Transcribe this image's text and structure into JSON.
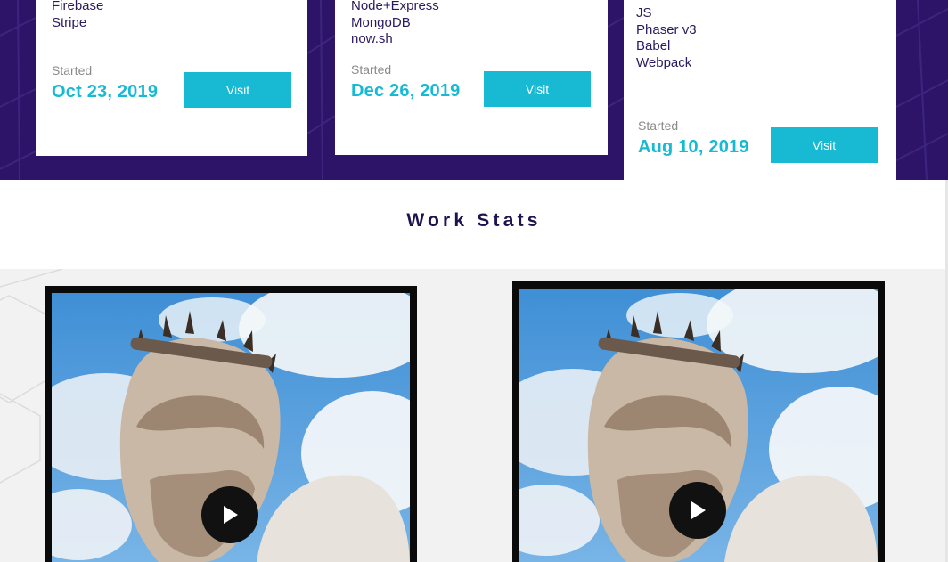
{
  "projects": [
    {
      "tech": [
        "Firebase",
        "Stripe"
      ],
      "started_label": "Started",
      "started_date": "Oct 23, 2019",
      "visit_label": "Visit"
    },
    {
      "tech": [
        "Node+Express",
        "MongoDB",
        "now.sh"
      ],
      "started_label": "Started",
      "started_date": "Dec 26, 2019",
      "visit_label": "Visit"
    },
    {
      "tech": [
        "JS",
        "Phaser v3",
        "Babel",
        "Webpack"
      ],
      "started_label": "Started",
      "started_date": "Aug 10, 2019",
      "visit_label": "Visit"
    }
  ],
  "work_stats": {
    "title": "Work Stats",
    "videos": [
      {
        "thumbnail": "statue-bust-icon",
        "play": "play-icon"
      },
      {
        "thumbnail": "statue-bust-icon",
        "play": "play-icon"
      }
    ]
  },
  "colors": {
    "band": "#2d1468",
    "accent": "#17b9d3",
    "title": "#1e1250"
  }
}
